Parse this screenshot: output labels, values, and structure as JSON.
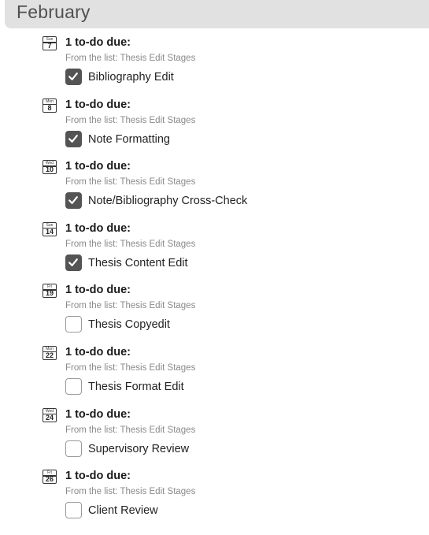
{
  "month": "February",
  "todos": [
    {
      "dow": "Sun",
      "day": "7",
      "due": "1 to-do due:",
      "from": "From the list: Thesis Edit Stages",
      "task": "Bibliography Edit",
      "checked": true
    },
    {
      "dow": "Mon",
      "day": "8",
      "due": "1 to-do due:",
      "from": "From the list: Thesis Edit Stages",
      "task": "Note Formatting",
      "checked": true
    },
    {
      "dow": "Wed",
      "day": "10",
      "due": "1 to-do due:",
      "from": "From the list: Thesis Edit Stages",
      "task": "Note/Bibliography Cross-Check",
      "checked": true
    },
    {
      "dow": "Sun",
      "day": "14",
      "due": "1 to-do due:",
      "from": "From the list: Thesis Edit Stages",
      "task": "Thesis Content Edit",
      "checked": true
    },
    {
      "dow": "Fri",
      "day": "19",
      "due": "1 to-do due:",
      "from": "From the list: Thesis Edit Stages",
      "task": "Thesis Copyedit",
      "checked": false
    },
    {
      "dow": "Mon",
      "day": "22",
      "due": "1 to-do due:",
      "from": "From the list: Thesis Edit Stages",
      "task": "Thesis Format Edit",
      "checked": false
    },
    {
      "dow": "Wed",
      "day": "24",
      "due": "1 to-do due:",
      "from": "From the list: Thesis Edit Stages",
      "task": "Supervisory Review",
      "checked": false
    },
    {
      "dow": "Fri",
      "day": "26",
      "due": "1 to-do due:",
      "from": "From the list: Thesis Edit Stages",
      "task": "Client Review",
      "checked": false
    }
  ]
}
